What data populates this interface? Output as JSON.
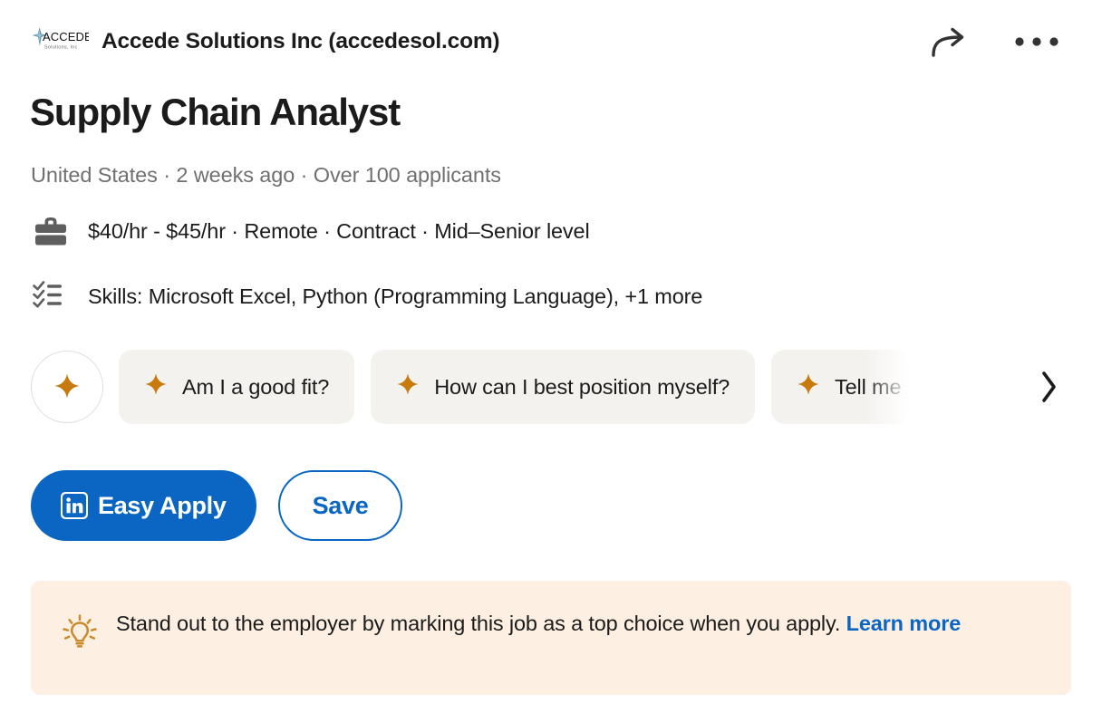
{
  "header": {
    "company_name": "Accede Solutions Inc (accedesol.com)",
    "logo_main_text": "ACCEDE",
    "logo_sub_text": "Solutions, Inc",
    "share_icon": "share-arrow-icon",
    "more_icon": "more-horizontal-icon",
    "logo_accent_color": "#5a8fa8"
  },
  "job": {
    "title": "Supply Chain Analyst",
    "meta": "United States · 2 weeks ago · Over 100 applicants",
    "salary_line": "$40/hr - $45/hr · Remote · Contract · Mid–Senior level",
    "skills_line": "Skills: Microsoft Excel, Python (Programming Language), +1 more",
    "salary_icon": "briefcase-icon",
    "skills_icon": "checklist-icon"
  },
  "ai_chips": {
    "sparkle_icon": "sparkle-icon",
    "next_icon": "chevron-right-icon",
    "items": [
      {
        "label": "Am I a good fit?",
        "truncated": false
      },
      {
        "label": "How can I best position myself?",
        "truncated": false
      },
      {
        "label": "Tell me",
        "truncated": true
      }
    ]
  },
  "actions": {
    "apply_label": "Easy Apply",
    "apply_icon": "linkedin-icon",
    "save_label": "Save"
  },
  "promo": {
    "icon": "lightbulb-icon",
    "text": "Stand out to the employer by marking this job as a top choice when you apply. ",
    "link_label": "Learn more"
  },
  "colors": {
    "linkedin_blue": "#0a66c2",
    "sparkle_amber": "#C77B0F",
    "chip_bg": "#f4f2ef",
    "promo_bg": "#fdf0e2",
    "promo_icon": "#C98B2E",
    "text_primary": "#1b1b1b",
    "text_muted": "#707070"
  }
}
